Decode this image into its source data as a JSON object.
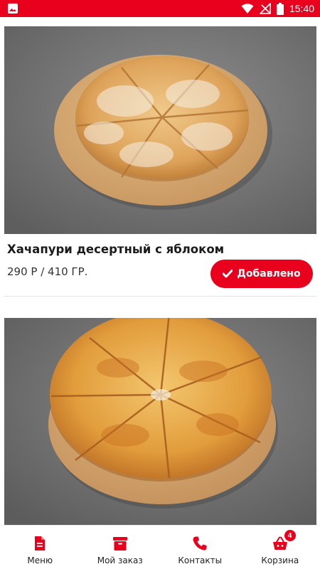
{
  "status_bar": {
    "time": "15:40",
    "color": "#e8001c",
    "icons": [
      "image-icon",
      "wifi-icon",
      "no-signal-icon",
      "battery-icon"
    ]
  },
  "products": [
    {
      "title": "Хачапури десертный с яблоком",
      "price": "290 Р / 410 ГР.",
      "button_label": "Добавлено",
      "image": "dessert-khachapuri-photo"
    },
    {
      "title": "",
      "price": "",
      "button_label": "",
      "image": "khachapuri-photo"
    }
  ],
  "bottom_nav": {
    "items": [
      {
        "label": "Меню",
        "icon": "document-icon"
      },
      {
        "label": "Мой заказ",
        "icon": "archive-box-icon"
      },
      {
        "label": "Контакты",
        "icon": "phone-icon"
      },
      {
        "label": "Корзина",
        "icon": "basket-icon",
        "badge": "4"
      }
    ]
  },
  "colors": {
    "accent": "#e8001c"
  }
}
